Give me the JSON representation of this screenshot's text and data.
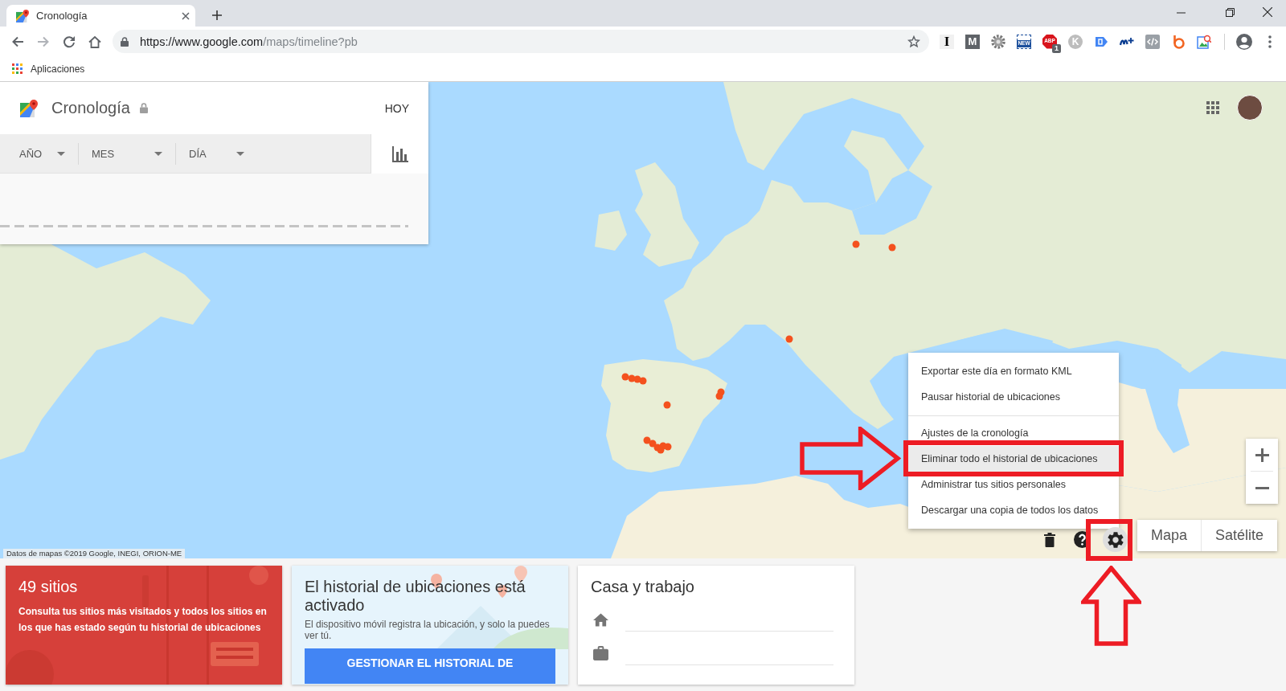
{
  "browser": {
    "tabs": [
      {
        "title": "Cronología",
        "selected": true
      }
    ],
    "address_bar": {
      "url_host": "https://www.google.com",
      "url_path": "/maps/timeline?pb"
    },
    "extensions": [
      {
        "kind": "serif",
        "label": "I"
      },
      {
        "kind": "tile",
        "label": "M"
      },
      {
        "kind": "gear"
      },
      {
        "kind": "news",
        "label": "NEW"
      },
      {
        "kind": "octagon",
        "label": "ABP",
        "badge": "1"
      },
      {
        "kind": "disc",
        "label": "K"
      },
      {
        "kind": "tag"
      },
      {
        "kind": "swoosh"
      },
      {
        "kind": "code"
      },
      {
        "kind": "ring"
      },
      {
        "kind": "image-search"
      }
    ],
    "bookmarks": [
      {
        "label": "Aplicaciones"
      }
    ]
  },
  "timeline": {
    "title": "Cronología",
    "today_button": "HOY",
    "filters": [
      {
        "label": "AÑO"
      },
      {
        "label": "MES"
      },
      {
        "label": "DÍA"
      }
    ]
  },
  "map": {
    "attribution": "Datos de mapas ©2019 Google, INEGI, ORION-ME",
    "settings_menu": {
      "sections": [
        {
          "items": [
            {
              "label": "Exportar este día en formato KML",
              "selected": false
            },
            {
              "label": "Pausar historial de ubicaciones",
              "selected": false
            }
          ]
        },
        {
          "items": [
            {
              "label": "Ajustes de la cronología",
              "selected": false
            },
            {
              "label": "Eliminar todo el historial de ubicaciones",
              "selected": true
            },
            {
              "label": "Administrar tus sitios personales",
              "selected": false
            },
            {
              "label": "Descargar una copia de todos los datos",
              "selected": false
            }
          ]
        }
      ]
    },
    "tools": [
      {
        "kind": "trash",
        "active": false
      },
      {
        "kind": "help",
        "active": false
      },
      {
        "kind": "settings",
        "active": true
      }
    ],
    "map_types": [
      {
        "label": "Mapa"
      },
      {
        "label": "Satélite"
      }
    ]
  },
  "cards": [
    {
      "kind": "places",
      "title": "49 sitios",
      "text": "Consulta tus sitios más visitados y todos los sitios en los que has estado según tu historial de ubicaciones"
    },
    {
      "kind": "history",
      "title": "El historial de ubicaciones está activado",
      "text": "El dispositivo móvil registra la ubicación, y solo la puedes ver tú.",
      "button": "GESTIONAR EL HISTORIAL DE"
    },
    {
      "kind": "home-work",
      "title": "Casa y trabajo",
      "rows": [
        {
          "kind": "home"
        },
        {
          "kind": "work"
        }
      ]
    }
  ],
  "annotations": [
    {
      "kind": "arrow",
      "vertical": false
    },
    {
      "kind": "frame"
    },
    {
      "kind": "frame"
    },
    {
      "kind": "arrow",
      "vertical": true
    }
  ]
}
